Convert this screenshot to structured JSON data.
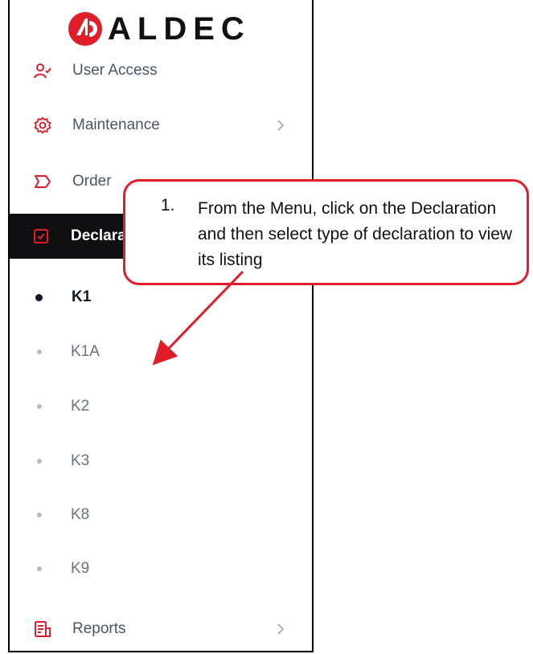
{
  "brand": {
    "name": "ALDEC",
    "accent": "#e11d2a"
  },
  "sidebar": {
    "items": [
      {
        "label": "User Access",
        "icon": "user-access-icon"
      },
      {
        "label": "Maintenance",
        "icon": "gear-icon",
        "has_submenu": true
      },
      {
        "label": "Order",
        "icon": "order-tag-icon"
      },
      {
        "label": "Declarat",
        "icon": "declaration-check-icon",
        "active": true
      },
      {
        "label": "Reports",
        "icon": "reports-icon",
        "has_submenu": true
      }
    ],
    "declaration_sub": [
      {
        "label": "K1",
        "active": true
      },
      {
        "label": "K1A"
      },
      {
        "label": "K2"
      },
      {
        "label": "K3"
      },
      {
        "label": "K8"
      },
      {
        "label": "K9"
      }
    ]
  },
  "callout": {
    "number": "1.",
    "text": "From the Menu, click on the Declaration and then select type of declaration to view its listing"
  }
}
